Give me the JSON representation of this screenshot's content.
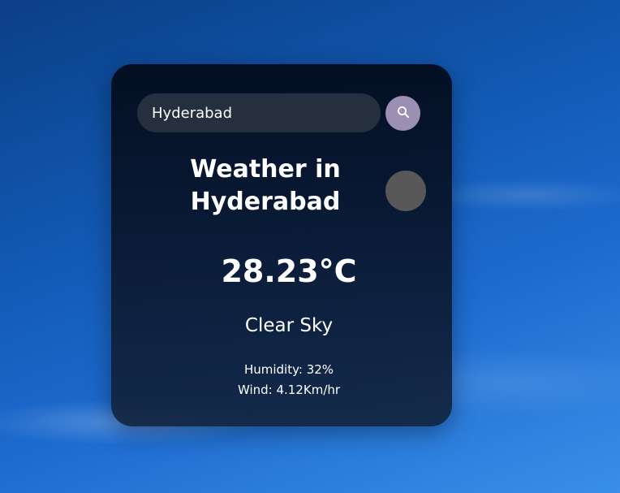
{
  "search": {
    "value": "Hyderabad",
    "placeholder": "Search",
    "icon": "search-icon",
    "button_color": "#9b8fb4"
  },
  "weather": {
    "title_line1": "Weather in",
    "title_line2": "Hyderabad",
    "icon": "weather-icon",
    "temperature": "28.23°C",
    "description": "Clear Sky",
    "humidity": "Humidity: 32%",
    "wind": "Wind: 4.12Km/hr"
  }
}
